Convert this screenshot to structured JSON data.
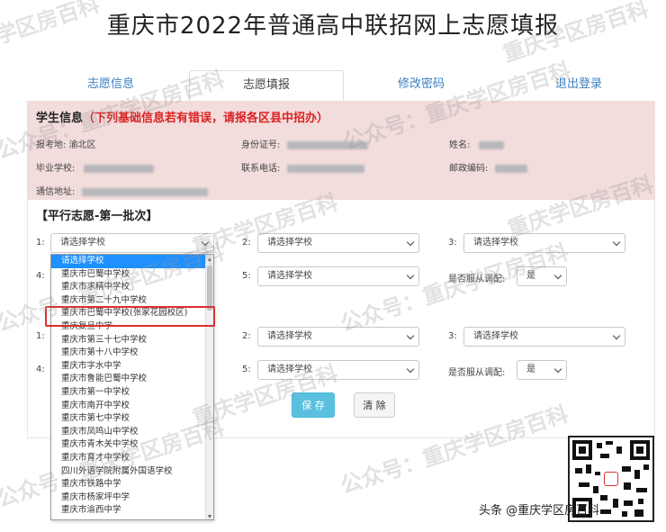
{
  "page": {
    "title": "重庆市2022年普通高中联招网上志愿填报"
  },
  "tabs": [
    {
      "label": "志愿信息"
    },
    {
      "label": "志愿填报"
    },
    {
      "label": "修改密码"
    },
    {
      "label": "退出登录"
    }
  ],
  "student_info": {
    "title": "学生信息",
    "warning": "（下列基础信息若有错误，请报各区县中招办）",
    "exam_place_label": "报考地:",
    "exam_place_value": "渝北区",
    "id_label": "身份证号:",
    "name_label": "姓名:",
    "school_label": "毕业学校:",
    "phone_label": "联系电话:",
    "zip_label": "邮政编码:",
    "address_label": "通信地址:"
  },
  "section": {
    "title": "【平行志愿-第一批次】"
  },
  "form": {
    "placeholder": "请选择学校",
    "labels": {
      "n1": "1:",
      "n2": "2:",
      "n3": "3:",
      "n4": "4:",
      "n5": "5:"
    },
    "adjust_label": "是否服从调配:",
    "adjust_value": "是"
  },
  "buttons": {
    "save": "保 存",
    "clear": "清 除"
  },
  "dropdown_options": [
    "请选择学校",
    "重庆市巴蜀中学校",
    "重庆市求精中学校",
    "重庆市第二十九中学校",
    "重庆市巴蜀中学校(张家花园校区)",
    "重庆复旦中学",
    "重庆市第三十七中学校",
    "重庆市第十八中学校",
    "重庆市字水中学",
    "重庆市鲁能巴蜀中学校",
    "重庆市第一中学校",
    "重庆市南开中学校",
    "重庆市第七中学校",
    "重庆市凤鸣山中学校",
    "重庆市青木关中学校",
    "重庆市育才中学校",
    "四川外语学院附属外国语学校",
    "重庆市铁路中学",
    "重庆市杨家坪中学",
    "重庆市渝西中学"
  ],
  "watermark": {
    "text1": "公众号：重庆学区房百科",
    "text2": "重庆学区房百科"
  },
  "footer": {
    "text": "头条 @重庆学区房百科"
  }
}
